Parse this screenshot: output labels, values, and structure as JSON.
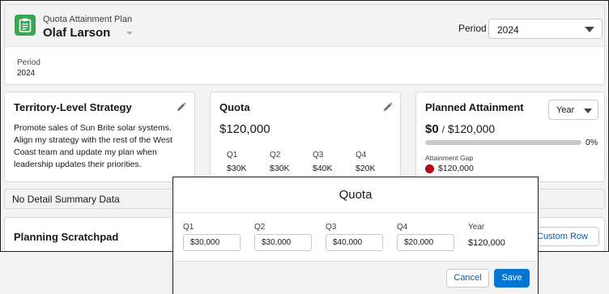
{
  "header": {
    "object_label": "Quota Attainment Plan",
    "record_name": "Olaf Larson",
    "period_label": "Period",
    "period_value": "2024"
  },
  "detail": {
    "period_label": "Period",
    "period_value": "2024"
  },
  "territory_card": {
    "title": "Territory-Level Strategy",
    "body": "Promote sales of Sun Brite solar systems. Align my strategy with the rest of the West Coast team and update my plan when leadership updates their priorities."
  },
  "quota_card": {
    "title": "Quota",
    "total": "$120,000",
    "quarters": [
      {
        "label": "Q1",
        "value": "$30K"
      },
      {
        "label": "Q2",
        "value": "$30K"
      },
      {
        "label": "Q3",
        "value": "$40K"
      },
      {
        "label": "Q4",
        "value": "$20K"
      }
    ]
  },
  "attainment_card": {
    "title": "Planned Attainment",
    "range_value": "Year",
    "planned": "$0",
    "separator": "/",
    "target": "$120,000",
    "progress_percent": 0,
    "progress_label": "0%",
    "gap_label": "Attainment Gap",
    "gap_value": "$120,000",
    "gap_color": "#ba0517"
  },
  "summary": {
    "text": "No Detail Summary Data"
  },
  "scratchpad": {
    "title": "Planning Scratchpad",
    "custom_row_label": "Custom Row"
  },
  "modal": {
    "title": "Quota",
    "fields": [
      {
        "label": "Q1",
        "value": "$30,000"
      },
      {
        "label": "Q2",
        "value": "$30,000"
      },
      {
        "label": "Q3",
        "value": "$40,000"
      },
      {
        "label": "Q4",
        "value": "$20,000"
      }
    ],
    "year_label": "Year",
    "year_value": "$120,000",
    "cancel_label": "Cancel",
    "save_label": "Save"
  },
  "colors": {
    "app_icon": "#3ba755",
    "brand": "#0176d3"
  }
}
